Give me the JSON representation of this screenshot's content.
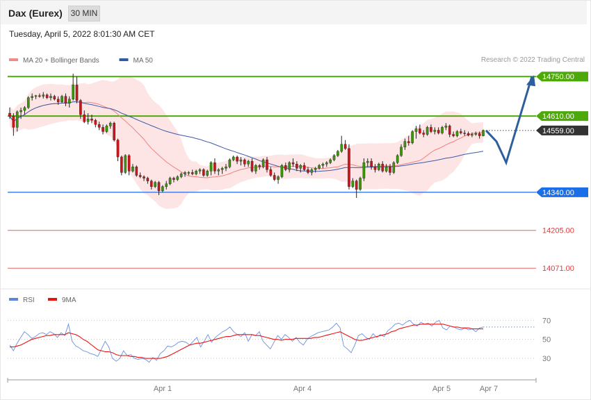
{
  "header": {
    "instrument": "Dax (Eurex)",
    "timeframe": "30 MIN"
  },
  "datetime": "Tuesday, April 5, 2022 8:01:30 AM CET",
  "copyright": "Research © 2022 Trading Central",
  "colors": {
    "up": "#3a9a06",
    "down": "#d0141b",
    "resistance": "#4fa80a",
    "support": "#1a6ee6",
    "target": "#e23b3b",
    "current": "#333333",
    "forecast_arrow": "#2d5f9e",
    "ma20": "#f08080",
    "ma50": "#3a5aa8",
    "band": "#fde2e2",
    "rsi": "#6a8fe0",
    "rsi_ma": "#e11"
  },
  "chart_data": [
    {
      "type": "candlestick",
      "legend": [
        {
          "name": "MA 20 + Bollinger Bands",
          "color": "#f28a8a"
        },
        {
          "name": "MA 50",
          "color": "#2f5ca0"
        }
      ],
      "x_ticks": [
        "Apr 1",
        "Apr 4",
        "Apr 5",
        "Apr 7"
      ],
      "ylim": [
        14010,
        14780
      ],
      "levels": [
        {
          "label": "14750.00",
          "value": 14750,
          "kind": "resistance"
        },
        {
          "label": "14610.00",
          "value": 14610,
          "kind": "resistance"
        },
        {
          "label": "14559.00",
          "value": 14559,
          "kind": "current"
        },
        {
          "label": "14340.00",
          "value": 14340,
          "kind": "support"
        },
        {
          "label": "14205.00",
          "value": 14205,
          "kind": "target"
        },
        {
          "label": "14071.00",
          "value": 14071,
          "kind": "target"
        }
      ],
      "forecast_path": [
        14559,
        14520,
        14445,
        14750
      ],
      "candles": [
        [
          14620,
          14640,
          14600,
          14610
        ],
        [
          14610,
          14620,
          14540,
          14570
        ],
        [
          14570,
          14630,
          14555,
          14625
        ],
        [
          14625,
          14640,
          14600,
          14630
        ],
        [
          14630,
          14645,
          14615,
          14640
        ],
        [
          14640,
          14680,
          14635,
          14675
        ],
        [
          14675,
          14690,
          14665,
          14680
        ],
        [
          14680,
          14685,
          14670,
          14682
        ],
        [
          14682,
          14690,
          14675,
          14680
        ],
        [
          14680,
          14695,
          14672,
          14685
        ],
        [
          14685,
          14690,
          14670,
          14675
        ],
        [
          14675,
          14690,
          14665,
          14680
        ],
        [
          14680,
          14685,
          14665,
          14670
        ],
        [
          14670,
          14680,
          14650,
          14660
        ],
        [
          14660,
          14685,
          14655,
          14680
        ],
        [
          14680,
          14690,
          14645,
          14655
        ],
        [
          14655,
          14680,
          14640,
          14670
        ],
        [
          14670,
          14760,
          14665,
          14720
        ],
        [
          14720,
          14750,
          14655,
          14665
        ],
        [
          14665,
          14670,
          14600,
          14615
        ],
        [
          14615,
          14630,
          14585,
          14590
        ],
        [
          14590,
          14620,
          14580,
          14600
        ],
        [
          14600,
          14615,
          14585,
          14595
        ],
        [
          14595,
          14600,
          14570,
          14580
        ],
        [
          14580,
          14590,
          14560,
          14570
        ],
        [
          14570,
          14580,
          14545,
          14555
        ],
        [
          14555,
          14580,
          14550,
          14575
        ],
        [
          14575,
          14590,
          14565,
          14585
        ],
        [
          14585,
          14590,
          14520,
          14525
        ],
        [
          14525,
          14530,
          14450,
          14465
        ],
        [
          14465,
          14470,
          14400,
          14410
        ],
        [
          14410,
          14475,
          14405,
          14470
        ],
        [
          14470,
          14475,
          14400,
          14415
        ],
        [
          14415,
          14440,
          14410,
          14430
        ],
        [
          14430,
          14435,
          14395,
          14400
        ],
        [
          14400,
          14410,
          14390,
          14395
        ],
        [
          14395,
          14400,
          14380,
          14390
        ],
        [
          14390,
          14395,
          14370,
          14380
        ],
        [
          14380,
          14385,
          14350,
          14360
        ],
        [
          14360,
          14380,
          14355,
          14375
        ],
        [
          14375,
          14380,
          14330,
          14345
        ],
        [
          14345,
          14365,
          14340,
          14360
        ],
        [
          14360,
          14380,
          14350,
          14370
        ],
        [
          14370,
          14395,
          14365,
          14390
        ],
        [
          14390,
          14395,
          14375,
          14385
        ],
        [
          14385,
          14400,
          14380,
          14395
        ],
        [
          14395,
          14410,
          14390,
          14405
        ],
        [
          14405,
          14415,
          14395,
          14410
        ],
        [
          14410,
          14415,
          14400,
          14410
        ],
        [
          14410,
          14420,
          14400,
          14405
        ],
        [
          14405,
          14420,
          14400,
          14415
        ],
        [
          14415,
          14425,
          14405,
          14420
        ],
        [
          14420,
          14425,
          14395,
          14400
        ],
        [
          14400,
          14420,
          14395,
          14415
        ],
        [
          14415,
          14450,
          14400,
          14445
        ],
        [
          14445,
          14460,
          14405,
          14415
        ],
        [
          14415,
          14425,
          14400,
          14420
        ],
        [
          14420,
          14430,
          14405,
          14425
        ],
        [
          14425,
          14440,
          14415,
          14430
        ],
        [
          14430,
          14460,
          14425,
          14455
        ],
        [
          14455,
          14470,
          14450,
          14465
        ],
        [
          14465,
          14470,
          14440,
          14450
        ],
        [
          14450,
          14465,
          14435,
          14455
        ],
        [
          14455,
          14460,
          14430,
          14440
        ],
        [
          14440,
          14455,
          14430,
          14450
        ],
        [
          14450,
          14460,
          14410,
          14415
        ],
        [
          14415,
          14440,
          14405,
          14435
        ],
        [
          14435,
          14440,
          14420,
          14430
        ],
        [
          14430,
          14460,
          14425,
          14455
        ],
        [
          14455,
          14465,
          14410,
          14420
        ],
        [
          14420,
          14430,
          14395,
          14400
        ],
        [
          14400,
          14410,
          14380,
          14385
        ],
        [
          14385,
          14400,
          14370,
          14395
        ],
        [
          14395,
          14440,
          14390,
          14435
        ],
        [
          14435,
          14445,
          14415,
          14420
        ],
        [
          14420,
          14450,
          14410,
          14445
        ],
        [
          14445,
          14460,
          14430,
          14440
        ],
        [
          14440,
          14450,
          14415,
          14425
        ],
        [
          14425,
          14440,
          14410,
          14435
        ],
        [
          14435,
          14445,
          14415,
          14420
        ],
        [
          14420,
          14430,
          14405,
          14410
        ],
        [
          14410,
          14425,
          14400,
          14420
        ],
        [
          14420,
          14430,
          14410,
          14425
        ],
        [
          14425,
          14440,
          14420,
          14435
        ],
        [
          14435,
          14445,
          14425,
          14440
        ],
        [
          14440,
          14450,
          14430,
          14445
        ],
        [
          14445,
          14460,
          14440,
          14455
        ],
        [
          14455,
          14475,
          14450,
          14470
        ],
        [
          14470,
          14490,
          14465,
          14485
        ],
        [
          14485,
          14540,
          14480,
          14510
        ],
        [
          14510,
          14525,
          14490,
          14495
        ],
        [
          14495,
          14510,
          14350,
          14360
        ],
        [
          14360,
          14390,
          14355,
          14380
        ],
        [
          14380,
          14385,
          14320,
          14350
        ],
        [
          14350,
          14395,
          14345,
          14390
        ],
        [
          14390,
          14460,
          14380,
          14445
        ],
        [
          14445,
          14460,
          14430,
          14450
        ],
        [
          14450,
          14460,
          14420,
          14430
        ],
        [
          14430,
          14440,
          14410,
          14420
        ],
        [
          14420,
          14445,
          14415,
          14440
        ],
        [
          14440,
          14450,
          14410,
          14415
        ],
        [
          14415,
          14440,
          14410,
          14430
        ],
        [
          14430,
          14440,
          14400,
          14410
        ],
        [
          14410,
          14450,
          14405,
          14445
        ],
        [
          14445,
          14475,
          14440,
          14470
        ],
        [
          14470,
          14510,
          14465,
          14500
        ],
        [
          14500,
          14530,
          14490,
          14520
        ],
        [
          14520,
          14540,
          14505,
          14515
        ],
        [
          14515,
          14560,
          14510,
          14555
        ],
        [
          14555,
          14575,
          14530,
          14565
        ],
        [
          14565,
          14580,
          14545,
          14550
        ],
        [
          14550,
          14560,
          14535,
          14545
        ],
        [
          14545,
          14575,
          14540,
          14570
        ],
        [
          14570,
          14580,
          14550,
          14555
        ],
        [
          14555,
          14570,
          14545,
          14560
        ],
        [
          14560,
          14570,
          14545,
          14550
        ],
        [
          14550,
          14575,
          14545,
          14570
        ],
        [
          14570,
          14585,
          14560,
          14575
        ],
        [
          14575,
          14580,
          14535,
          14545
        ],
        [
          14545,
          14555,
          14535,
          14540
        ],
        [
          14540,
          14560,
          14535,
          14555
        ],
        [
          14555,
          14565,
          14545,
          14550
        ],
        [
          14550,
          14560,
          14540,
          14548
        ],
        [
          14548,
          14555,
          14538,
          14542
        ],
        [
          14542,
          14552,
          14535,
          14545
        ],
        [
          14545,
          14555,
          14540,
          14548
        ],
        [
          14548,
          14555,
          14530,
          14540
        ],
        [
          14540,
          14562,
          14538,
          14559
        ]
      ]
    },
    {
      "type": "line",
      "legend": [
        {
          "name": "RSI",
          "color": "#5a86e0"
        },
        {
          "name": "9MA",
          "color": "#e11"
        }
      ],
      "ylim": [
        14,
        87
      ],
      "y_ticks": [
        70,
        50,
        30
      ],
      "series": [
        {
          "name": "RSI",
          "values": [
            44,
            38,
            46,
            52,
            58,
            55,
            51,
            53,
            56,
            57,
            55,
            58,
            56,
            52,
            57,
            54,
            66,
            48,
            43,
            41,
            38,
            37,
            35,
            34,
            32,
            40,
            48,
            42,
            30,
            27,
            30,
            38,
            33,
            34,
            30,
            29,
            30,
            29,
            26,
            31,
            28,
            35,
            38,
            43,
            42,
            44,
            47,
            48,
            47,
            44,
            48,
            52,
            42,
            48,
            55,
            47,
            52,
            55,
            58,
            60,
            63,
            58,
            55,
            53,
            57,
            48,
            55,
            54,
            58,
            48,
            44,
            40,
            47,
            54,
            50,
            55,
            52,
            48,
            52,
            47,
            44,
            50,
            53,
            55,
            57,
            58,
            59,
            60,
            63,
            67,
            62,
            43,
            40,
            36,
            44,
            54,
            56,
            52,
            50,
            56,
            52,
            55,
            53,
            59,
            62,
            66,
            67,
            65,
            68,
            70,
            66,
            64,
            68,
            66,
            67,
            64,
            68,
            70,
            62,
            60,
            64,
            63,
            61,
            60,
            62,
            60,
            61,
            58,
            62,
            63
          ]
        },
        {
          "name": "9MA",
          "values": [
            42,
            42,
            43,
            44,
            46,
            48,
            50,
            51,
            52,
            53,
            54,
            54,
            55,
            55,
            55,
            55,
            57,
            56,
            55,
            53,
            50,
            48,
            45,
            42,
            39,
            38,
            37,
            37,
            36,
            34,
            33,
            33,
            33,
            32,
            32,
            31,
            31,
            30,
            30,
            30,
            30,
            30,
            31,
            32,
            34,
            36,
            38,
            40,
            42,
            44,
            45,
            46,
            46,
            47,
            48,
            49,
            50,
            51,
            52,
            53,
            53,
            54,
            55,
            55,
            55,
            55,
            55,
            54,
            54,
            53,
            52,
            51,
            50,
            50,
            49,
            50,
            50,
            50,
            51,
            51,
            51,
            51,
            51,
            52,
            52,
            53,
            54,
            55,
            56,
            57,
            58,
            56,
            54,
            52,
            50,
            49,
            49,
            50,
            51,
            52,
            53,
            54,
            55,
            56,
            58,
            59,
            61,
            62,
            63,
            64,
            65,
            65,
            66,
            66,
            66,
            66,
            66,
            66,
            66,
            65,
            64,
            63,
            63,
            62,
            62,
            62,
            61,
            61,
            61,
            61
          ]
        }
      ]
    }
  ]
}
